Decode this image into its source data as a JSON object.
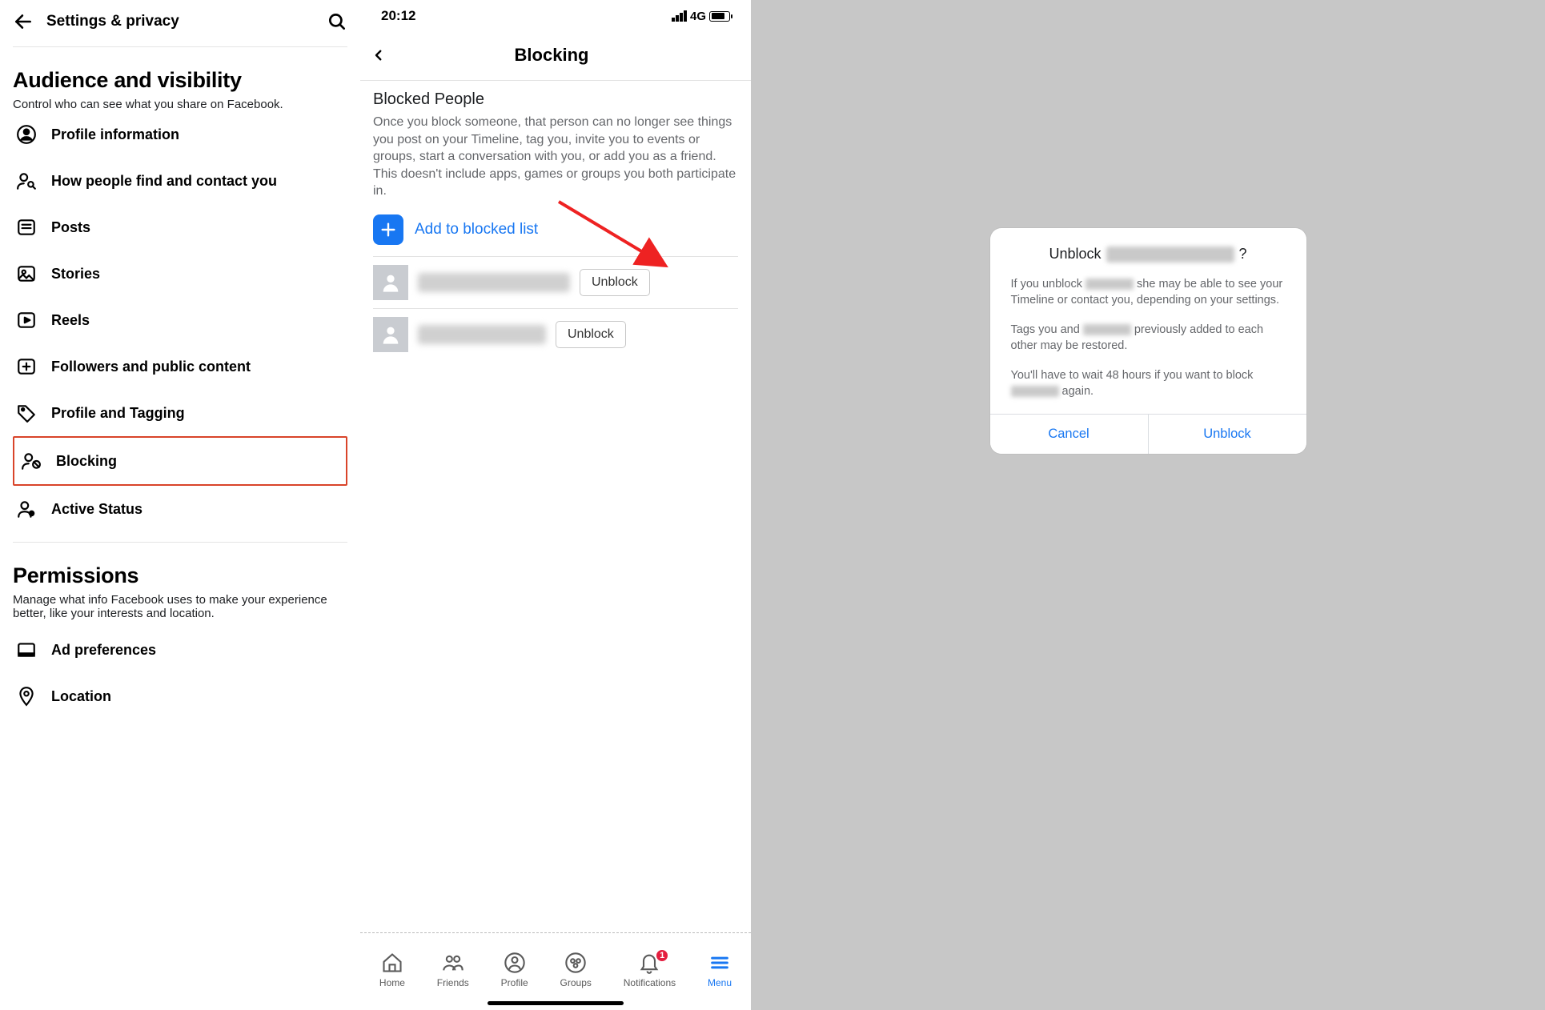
{
  "left": {
    "header_title": "Settings & privacy",
    "section1_title": "Audience and visibility",
    "section1_sub": "Control who can see what you share on Facebook.",
    "items": [
      "Profile information",
      "How people find and contact you",
      "Posts",
      "Stories",
      "Reels",
      "Followers and public content",
      "Profile and Tagging",
      "Blocking",
      "Active Status"
    ],
    "section2_title": "Permissions",
    "section2_sub": "Manage what info Facebook uses to make your experience better, like your interests and location.",
    "perm_items": [
      "Ad preferences",
      "Location"
    ]
  },
  "mid": {
    "time": "20:12",
    "network": "4G",
    "title": "Blocking",
    "blocked_title": "Blocked People",
    "blocked_desc": "Once you block someone, that person can no longer see things you post on your Timeline, tag you, invite you to events or groups, start a conversation with you, or add you as a friend. This doesn't include apps, games or groups you both participate in.",
    "add_label": "Add to blocked list",
    "unblock_label": "Unblock",
    "nav": [
      "Home",
      "Friends",
      "Profile",
      "Groups",
      "Notifications",
      "Menu"
    ],
    "notif_badge": "1"
  },
  "dialog": {
    "title_prefix": "Unblock",
    "title_suffix": "?",
    "p1_a": "If you unblock",
    "p1_b": "she may be able to see your Timeline or contact you, depending on your settings.",
    "p2_a": "Tags you and",
    "p2_b": "previously added to each other may be restored.",
    "p3_a": "You'll have to wait 48 hours if you want to block",
    "p3_b": "again.",
    "cancel": "Cancel",
    "unblock": "Unblock"
  }
}
